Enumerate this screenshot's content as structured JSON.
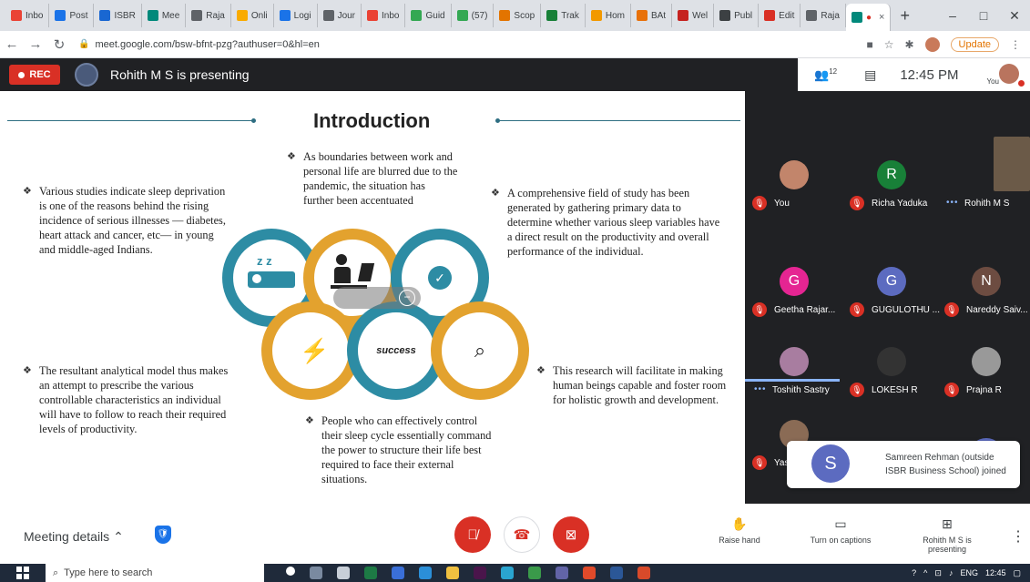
{
  "browser": {
    "tabs": [
      {
        "label": "Inbo",
        "color": "#ea4335"
      },
      {
        "label": "Post",
        "color": "#1a73e8"
      },
      {
        "label": "ISBR",
        "color": "#1967d2"
      },
      {
        "label": "Mee",
        "color": "#00897b"
      },
      {
        "label": "Raja",
        "color": "#5f6368"
      },
      {
        "label": "Onli",
        "color": "#f9ab00"
      },
      {
        "label": "Logi",
        "color": "#1a73e8"
      },
      {
        "label": "Jour",
        "color": "#5f6368"
      },
      {
        "label": "Inbo",
        "color": "#ea4335"
      },
      {
        "label": "Guid",
        "color": "#34a853"
      },
      {
        "label": "(57)",
        "color": "#34a853"
      },
      {
        "label": "Scop",
        "color": "#e37400"
      },
      {
        "label": "Trak",
        "color": "#188038"
      },
      {
        "label": "Hom",
        "color": "#f29900"
      },
      {
        "label": "BAt",
        "color": "#e8710a"
      },
      {
        "label": "Wel",
        "color": "#c5221f"
      },
      {
        "label": "Publ",
        "color": "#3c4043"
      },
      {
        "label": "Edit",
        "color": "#d93025"
      },
      {
        "label": "Raja",
        "color": "#5f6368"
      }
    ],
    "active_tab_close": "×",
    "new_tab": "+",
    "window_controls": {
      "minimize": "–",
      "maximize": "□",
      "close": "✕"
    },
    "url": "meet.google.com/bsw-bfnt-pzg?authuser=0&hl=en",
    "update_label": "Update"
  },
  "meet": {
    "rec_label": "REC",
    "presenting_text": "Rohith M S is presenting",
    "participants_count": "12",
    "time": "12:45 PM",
    "you_label": "You"
  },
  "slide": {
    "title": "Introduction",
    "paragraphs": [
      "Various studies indicate sleep deprivation is one of the reasons behind the rising incidence of serious illnesses — diabetes, heart attack and cancer, etc— in young and middle-aged Indians.",
      "As boundaries between work and personal life are blurred due to the pandemic, the situation has further been accentuated",
      "A comprehensive field of study has been generated by gathering primary data to determine whether various sleep variables have a direct result on the productivity and overall performance of the individual.",
      "The resultant analytical model thus makes an attempt to prescribe the various controllable characteristics an individual will have to follow to reach their required levels of productivity.",
      "People who can effectively control their sleep cycle essentially command the power to structure their life best required to face their external situations.",
      "This research will facilitate in making human beings capable and foster room for holistic growth and development."
    ],
    "icon_text_zz": "z z",
    "icon_text_success": "success",
    "colors": {
      "teal": "#2d8ca4",
      "gold": "#e3a22e",
      "line": "#2e6e82"
    }
  },
  "participants": [
    {
      "name": "You",
      "initial": "",
      "color": "#c2856b"
    },
    {
      "name": "Richa Yaduka",
      "initial": "R",
      "color": "#188038"
    },
    {
      "name": "Rohith M S",
      "initial": "",
      "color": "#6b5a48"
    },
    {
      "name": "Geetha Rajar...",
      "initial": "G",
      "color": "#e52592"
    },
    {
      "name": "GUGULOTHU ...",
      "initial": "G",
      "color": "#5c6bc0"
    },
    {
      "name": "Nareddy Saiv...",
      "initial": "N",
      "color": "#6d4c41"
    },
    {
      "name": "Toshith Sastry",
      "initial": "",
      "color": "#a87da0"
    },
    {
      "name": "LOKESH R",
      "initial": "",
      "color": "#333"
    },
    {
      "name": "Prajna R",
      "initial": "",
      "color": "#999"
    },
    {
      "name": "Yas",
      "initial": "",
      "color": "#8a6b55"
    },
    {
      "name": "",
      "initial": "S",
      "color": "#5c6bc0"
    }
  ],
  "toast": {
    "initial": "S",
    "text": "Samreen Rehman (outside ISBR Business School) joined"
  },
  "bottom": {
    "meeting_details": "Meeting details",
    "raise_hand": "Raise hand",
    "captions": "Turn on captions",
    "presenting": "Rohith M S is presenting",
    "more": "⋮"
  },
  "taskbar": {
    "search_placeholder": "Type here to search",
    "lang": "ENG",
    "time": "12:45"
  }
}
